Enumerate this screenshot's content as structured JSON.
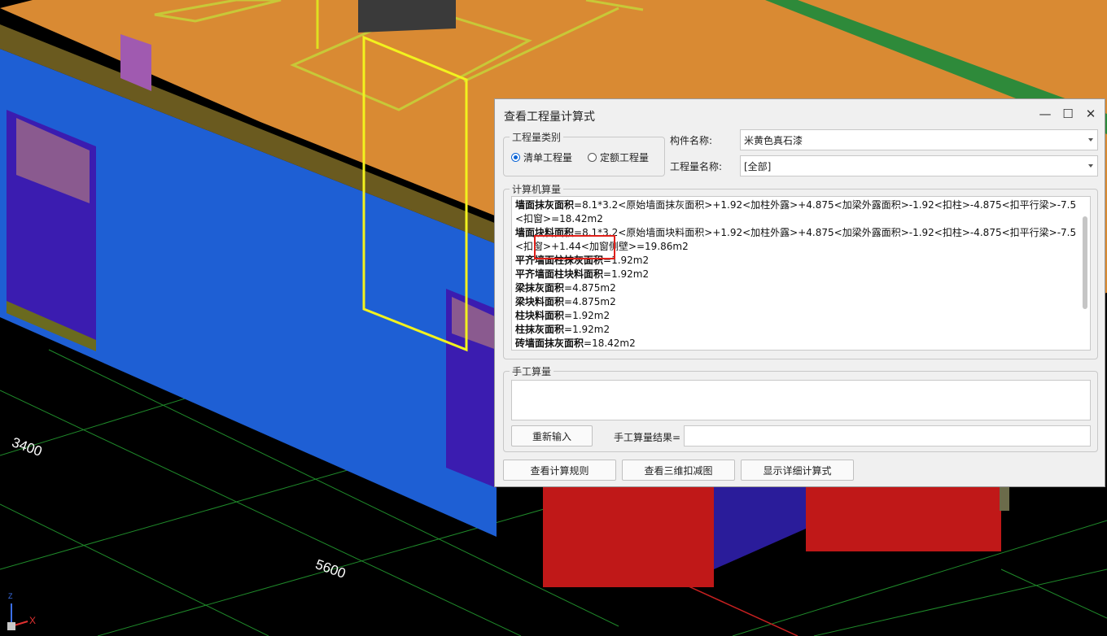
{
  "viewport": {
    "dim_labels": [
      "3400",
      "5600"
    ],
    "axis_x_label": "X",
    "axis_z_label": "Z"
  },
  "dialog": {
    "title": "查看工程量计算式",
    "controls": {
      "minimize": "—",
      "maximize": "☐",
      "close": "✕"
    },
    "quantity_type": {
      "legend": "工程量类别",
      "options": [
        "清单工程量",
        "定额工程量"
      ],
      "selected": "清单工程量"
    },
    "component_name": {
      "label": "构件名称:",
      "value": "米黄色真石漆"
    },
    "quantity_name": {
      "label": "工程量名称:",
      "value": "[全部]"
    },
    "computer_calc": {
      "legend": "计算机算量",
      "lines": [
        {
          "name": "墙面抹灰面积",
          "expr": "=8.1*3.2<原始墙面抹灰面积>+1.92<加柱外露>+4.875<加梁外露面积>-1.92<扣柱>-4.875<扣平行梁>-7.5<扣窗>=18.42m2"
        },
        {
          "name": "墙面块料面积",
          "expr": "=8.1*3.2<原始墙面块料面积>+1.92<加柱外露>+4.875<加梁外露面积>-1.92<扣柱>-4.875<扣平行梁>-7.5<扣窗>+1.44<加窗侧壁>=19.86m2"
        },
        {
          "name": "平齐墙面柱抹灰面积",
          "expr": "=1.92m2"
        },
        {
          "name": "平齐墙面柱块料面积",
          "expr": "=1.92m2"
        },
        {
          "name": "梁抹灰面积",
          "expr": "=4.875m2"
        },
        {
          "name": "梁块料面积",
          "expr": "=4.875m2"
        },
        {
          "name": "柱块料面积",
          "expr": "=1.92m2"
        },
        {
          "name": "柱抹灰面积",
          "expr": "=1.92m2"
        },
        {
          "name": "砖墙面抹灰面积",
          "expr": "=18.42m2"
        }
      ]
    },
    "manual_calc": {
      "legend": "手工算量",
      "input_value": "",
      "reinput_button": "重新输入",
      "result_label": "手工算量结果=",
      "result_value": ""
    },
    "footer_buttons": [
      "查看计算规则",
      "查看三维扣减图",
      "显示详细计算式"
    ],
    "highlight_color": "#e0201a"
  }
}
